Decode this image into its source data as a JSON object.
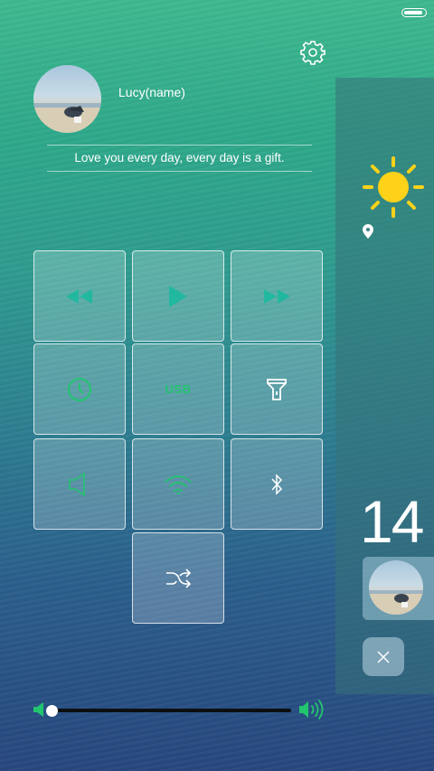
{
  "status_bar": {
    "battery_icon": "battery-icon"
  },
  "profile": {
    "name": "Lucy(name)",
    "motto": "Love you every day, every day is a gift."
  },
  "controls": {
    "tiles": [
      {
        "icon": "rewind-icon"
      },
      {
        "icon": "play-icon"
      },
      {
        "icon": "fast-forward-icon"
      },
      {
        "icon": "power-icon"
      },
      {
        "label": "USB"
      },
      {
        "icon": "flashlight-icon"
      },
      {
        "icon": "speaker-icon"
      },
      {
        "icon": "wifi-icon"
      },
      {
        "icon": "bluetooth-icon"
      },
      {
        "icon": "shuffle-icon"
      }
    ],
    "accent": "#22c56f"
  },
  "side_panel": {
    "weather_icon": "sun-icon",
    "location_icon": "location-pin-icon",
    "time_partial": "14"
  },
  "volume": {
    "level": 0.02
  }
}
